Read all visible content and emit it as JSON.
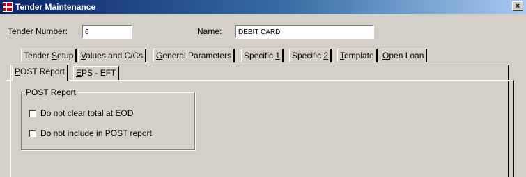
{
  "window": {
    "title": "Tender Maintenance",
    "icon": "app-grid-icon",
    "close_label": "×"
  },
  "form": {
    "tender_number_label": "Tender Number:",
    "tender_number_value": "6",
    "name_label": "Name:",
    "name_value": "DEBIT CARD"
  },
  "tabs": [
    {
      "pre": "Tender ",
      "key": "S",
      "post": "etup"
    },
    {
      "pre": "",
      "key": "V",
      "post": "alues and C/Cs"
    },
    {
      "pre": "",
      "key": "G",
      "post": "eneral Parameters"
    },
    {
      "pre": "Specific ",
      "key": "1",
      "post": ""
    },
    {
      "pre": "Specific ",
      "key": "2",
      "post": ""
    },
    {
      "pre": "",
      "key": "T",
      "post": "emplate"
    },
    {
      "pre": "",
      "key": "O",
      "post": "pen Loan"
    }
  ],
  "subtabs": [
    {
      "pre": "",
      "key": "P",
      "post": "OST Report",
      "active": true
    },
    {
      "pre": "",
      "key": "E",
      "post": "PS - EFT",
      "active": false
    }
  ],
  "post_report": {
    "group_title": "POST Report",
    "checkboxes": [
      {
        "label": "Do not clear total at EOD",
        "checked": false
      },
      {
        "label": "Do not include in POST report",
        "checked": false
      }
    ]
  }
}
